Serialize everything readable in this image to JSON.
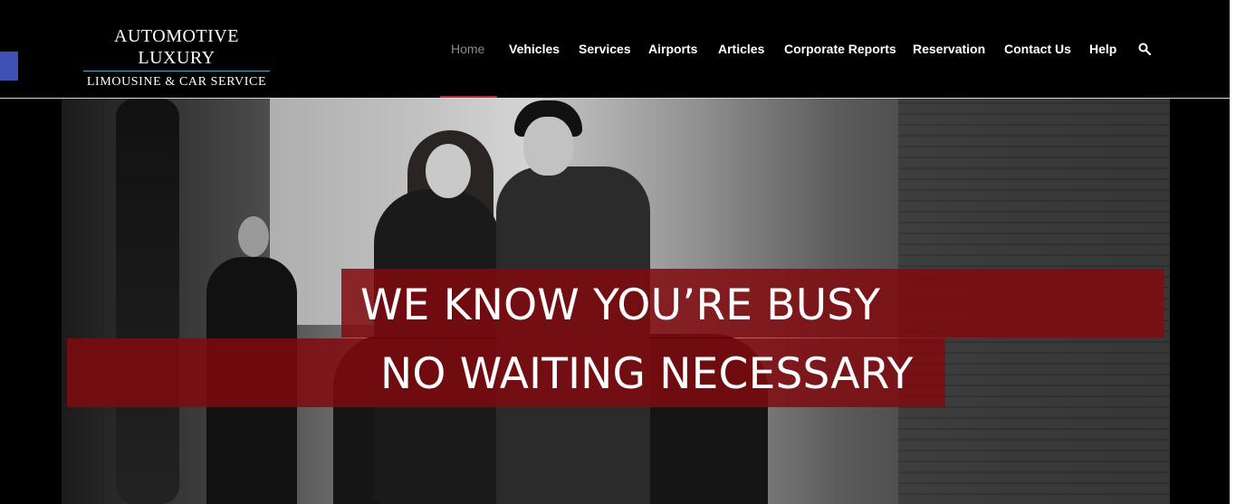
{
  "logo": {
    "line1": "AUTOMOTIVE LUXURY",
    "line2": "LIMOUSINE & CAR SERVICE"
  },
  "nav": {
    "items": [
      {
        "label": "Home",
        "active": true
      },
      {
        "label": "Vehicles",
        "active": false
      },
      {
        "label": "Services",
        "active": false
      },
      {
        "label": "Airports",
        "active": false
      },
      {
        "label": "Articles",
        "active": false
      },
      {
        "label": "Corporate Reports",
        "active": false
      },
      {
        "label": "Reservation",
        "active": false
      },
      {
        "label": "Contact Us",
        "active": false
      },
      {
        "label": "Help",
        "active": false
      }
    ],
    "search_icon": "search-icon"
  },
  "hero": {
    "headline1": "WE KNOW YOU’RE BUSY",
    "headline2": "NO WAITING NECESSARY"
  },
  "colors": {
    "background": "#000000",
    "banner": "#800a0e",
    "nav_active": "#8a8a8a",
    "active_underline": "#b03030",
    "side_tab": "#3f51b5"
  }
}
